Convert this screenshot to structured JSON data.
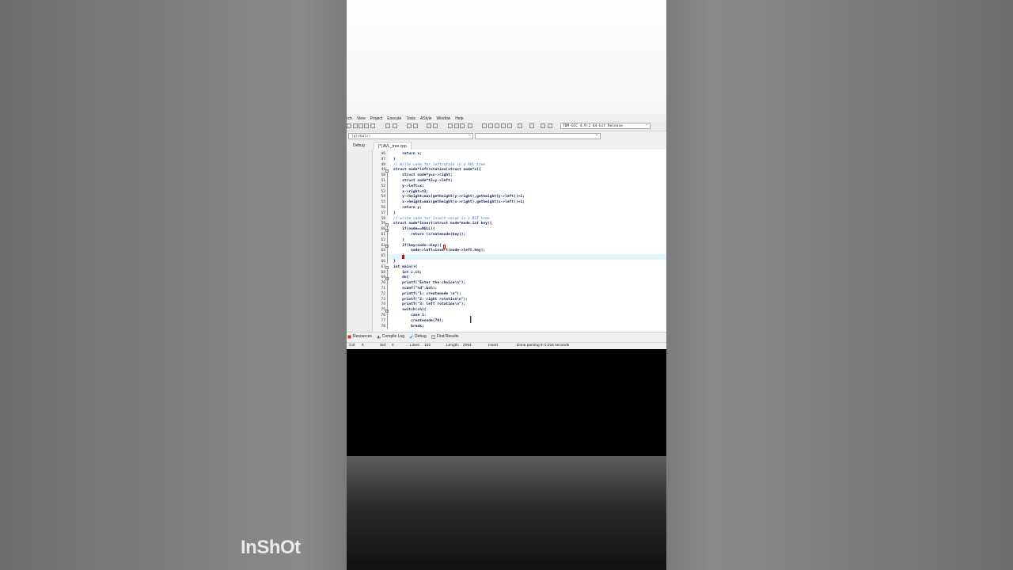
{
  "menu": [
    "rch",
    "View",
    "Project",
    "Execute",
    "Tools",
    "AStyle",
    "Window",
    "Help"
  ],
  "toolbar": {
    "compiler": "TDM-GCC 4.9.2 64-bit Release"
  },
  "scope": {
    "left": "(globals)"
  },
  "tabs": {
    "left_panel": "Debug",
    "file": "[*] AVL_tree.cpp"
  },
  "code_lines": [
    {
      "n": "46",
      "text": "    return x;",
      "type": "code"
    },
    {
      "n": "47",
      "text": "}",
      "type": "code"
    },
    {
      "n": "48",
      "text": "// Write code for leftrotate in a AVL tree",
      "type": "comment"
    },
    {
      "n": "49",
      "text": "struct node*leftrotation(struct node*x){",
      "type": "code"
    },
    {
      "n": "50",
      "text": "    struct node*y=x->right;",
      "type": "code"
    },
    {
      "n": "51",
      "text": "    struct node*t2=y->left;",
      "type": "code"
    },
    {
      "n": "52",
      "text": "    y->left=x;",
      "type": "code"
    },
    {
      "n": "53",
      "text": "    x->right=t2;",
      "type": "code"
    },
    {
      "n": "54",
      "text": "    y->height=max(getheight(y->right),getheight(y->left))+1;",
      "type": "code"
    },
    {
      "n": "55",
      "text": "    x->height=max(getheight(x->right),getheight(x->left))+1;",
      "type": "code"
    },
    {
      "n": "56",
      "text": "    return y;",
      "type": "code"
    },
    {
      "n": "57",
      "text": "}",
      "type": "code"
    },
    {
      "n": "58",
      "text": "// write code for insert value in a BST tree",
      "type": "comment"
    },
    {
      "n": "59",
      "text": "struct node*insert(struct node*node,int key){",
      "type": "code"
    },
    {
      "n": "60",
      "text": "    if(node==NULL){",
      "type": "code"
    },
    {
      "n": "61",
      "text": "        return (createnode(key));",
      "type": "code"
    },
    {
      "n": "62",
      "text": "    }",
      "type": "code"
    },
    {
      "n": "63",
      "text": "    if(key<node->key){",
      "type": "code"
    },
    {
      "n": "64",
      "text": "        node->left=insert(node->left,key);",
      "type": "code"
    },
    {
      "n": "65",
      "text": "    }",
      "type": "code"
    },
    {
      "n": "66",
      "text": "}",
      "type": "code"
    },
    {
      "n": "67",
      "text": "int main(){",
      "type": "code"
    },
    {
      "n": "68",
      "text": "    int c,ch;",
      "type": "code"
    },
    {
      "n": "69",
      "text": "    do{",
      "type": "code"
    },
    {
      "n": "70",
      "text": "    printf(\"Enter the choice\\n\");",
      "type": "code"
    },
    {
      "n": "71",
      "text": "    scanf(\"%d\",&ch);",
      "type": "code"
    },
    {
      "n": "72",
      "text": "    printf(\"1: createnode \\n\");",
      "type": "code"
    },
    {
      "n": "73",
      "text": "    printf(\"2: right rotation\\n\");",
      "type": "code"
    },
    {
      "n": "74",
      "text": "    printf(\"3: left rotation\\n\");",
      "type": "code"
    },
    {
      "n": "75",
      "text": "    switch(ch){",
      "type": "code"
    },
    {
      "n": "76",
      "text": "        case 1:",
      "type": "code"
    },
    {
      "n": "77",
      "text": "        createnode(70);",
      "type": "code"
    },
    {
      "n": "78",
      "text": "        break;",
      "type": "code"
    }
  ],
  "bottom_tabs": [
    {
      "label": "Resources",
      "icon": "resources-icon",
      "color": "#c0392b"
    },
    {
      "label": "Compile Log",
      "icon": "compile-log-icon",
      "color": "#555555"
    },
    {
      "label": "Debug",
      "icon": "debug-check-icon",
      "color": "#2e86de"
    },
    {
      "label": "Find Results",
      "icon": "find-results-icon",
      "color": "#7f8c8d"
    }
  ],
  "status": {
    "col_label": "Col:",
    "col": "6",
    "sel_label": "Sel:",
    "sel": "0",
    "lines_label": "Lines:",
    "lines": "102",
    "length_label": "Length:",
    "length": "2064",
    "mode": "Insert",
    "message": "Done parsing in 0.016 seconds"
  },
  "watermark": "InShOt"
}
